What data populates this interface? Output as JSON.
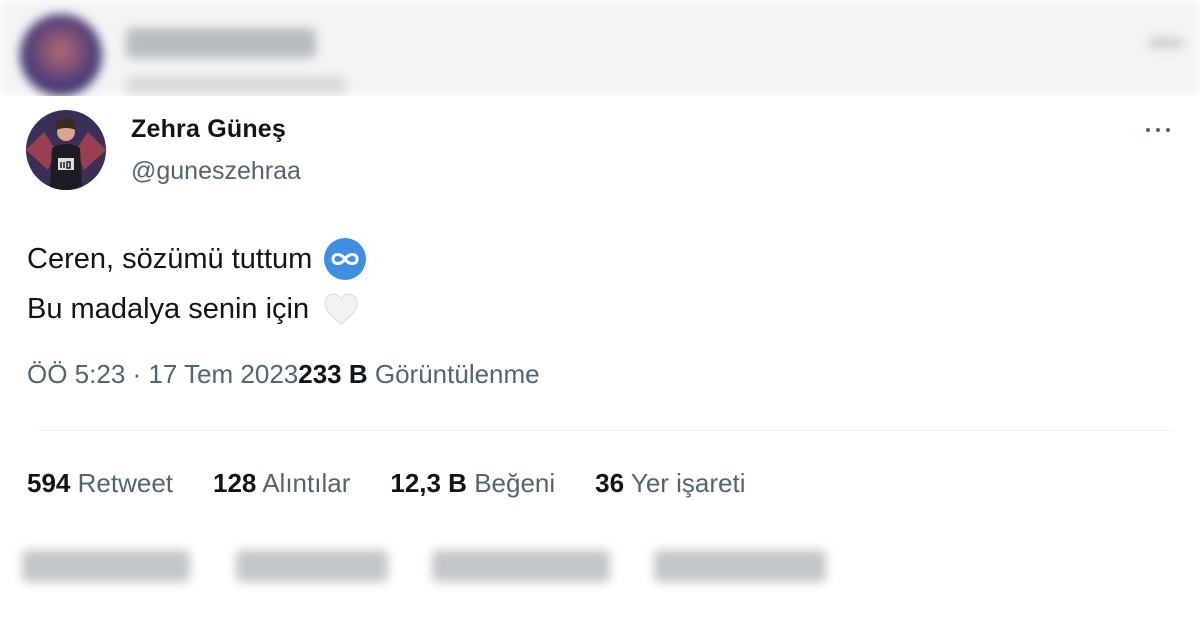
{
  "tweet": {
    "display_name": "Zehra Güneş",
    "handle": "@guneszehraa",
    "more_icon": "more-icon",
    "text_line_1": "Ceren, sözümü tuttum",
    "text_line_2": "Bu madalya senin için",
    "emoji_1": "infinity-emoji",
    "emoji_2": "white-heart-emoji",
    "timestamp": "ÖÖ 5:23 · 17 Tem 2023",
    "views_count": "233 B",
    "views_label": "Görüntülenme"
  },
  "stats": [
    {
      "count": "594",
      "label": "Retweet"
    },
    {
      "count": "128",
      "label": "Alıntılar"
    },
    {
      "count": "12,3 B",
      "label": "Beğeni"
    },
    {
      "count": "36",
      "label": "Yer işareti"
    }
  ],
  "colors": {
    "text_primary": "#0f1419",
    "text_secondary": "#536471",
    "divider": "#eff3f4",
    "infinity_emoji_bg": "#3e8fe0"
  }
}
